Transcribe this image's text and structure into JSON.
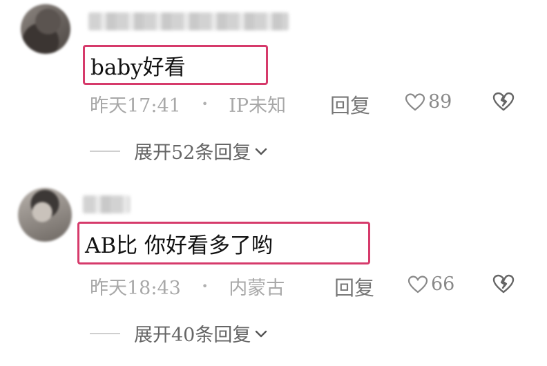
{
  "comments": [
    {
      "text": "baby好看",
      "time": "昨天17:41",
      "separator": "•",
      "location": "IP未知",
      "reply_label": "回复",
      "likes": "89",
      "expand_label": "展开52条回复"
    },
    {
      "text": "AB比 你好看多了哟",
      "time": "昨天18:43",
      "separator": "•",
      "location": "内蒙古",
      "reply_label": "回复",
      "likes": "66",
      "expand_label": "展开40条回复"
    }
  ],
  "colors": {
    "highlight_border": "#d63a6b",
    "meta_text": "#a8a8a8"
  },
  "icons": [
    "heart-outline-icon",
    "broken-heart-icon",
    "chevron-down-icon"
  ]
}
